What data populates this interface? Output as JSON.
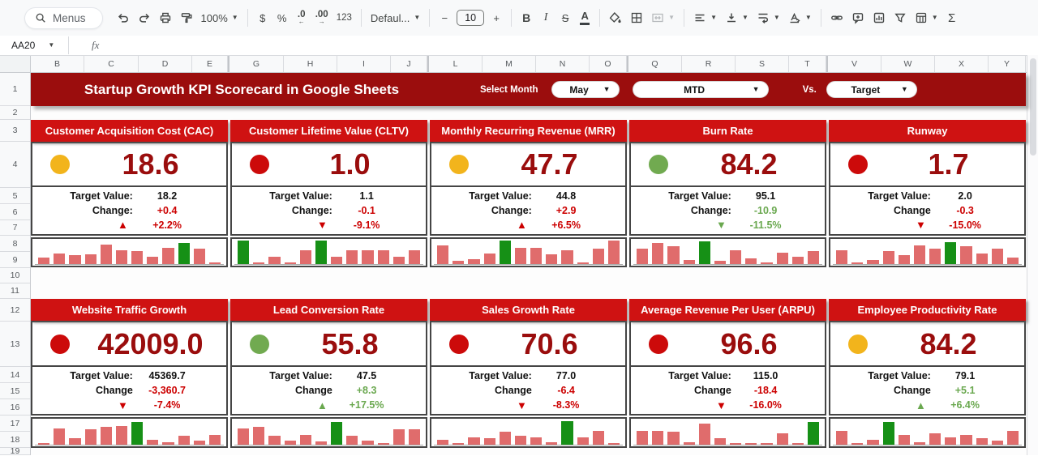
{
  "toolbar": {
    "menus": "Menus",
    "zoom": "100%",
    "currency": "$",
    "percent": "%",
    "decrease_decimals": ".0",
    "increase_decimals": ".00",
    "more_formats": "123",
    "font": "Defaul...",
    "minus": "−",
    "font_size": "10",
    "plus": "+",
    "bold": "B",
    "italic": "I",
    "strikethrough": "S",
    "text_color": "A",
    "functions": "Σ"
  },
  "formula_bar": {
    "name_box": "AA20",
    "fx": "fx"
  },
  "grid": {
    "columns": [
      "B",
      "C",
      "D",
      "E",
      "G",
      "H",
      "I",
      "J",
      "L",
      "M",
      "N",
      "O",
      "Q",
      "R",
      "S",
      "T",
      "V",
      "W",
      "X",
      "Y"
    ],
    "rows": [
      "1",
      "2",
      "3",
      "4",
      "5",
      "6",
      "7",
      "8",
      "9",
      "10",
      "11",
      "12",
      "13",
      "14",
      "15",
      "16",
      "17",
      "18",
      "19"
    ]
  },
  "header": {
    "title": "Startup Growth KPI Scorecard in Google Sheets",
    "select_month": "Select Month",
    "month": "May",
    "period": "MTD",
    "vs": "Vs.",
    "compare": "Target"
  },
  "colors": {
    "band_red": "#9b0d0d",
    "title_red": "#cf1212",
    "value_red": "#9a0d0d",
    "status_yellow": "#f2b41c",
    "status_red": "#cc0a0a",
    "status_green": "#71aa50",
    "good_green": "#6aa84f",
    "bad_red": "#cc0000",
    "spark_pink": "#e06c6c",
    "spark_green": "#169016"
  },
  "cards": [
    {
      "title": "Customer Acquisition Cost (CAC)",
      "status": "yellow",
      "value": "18.6",
      "target_label": "Target Value:",
      "target": "18.2",
      "change_label": "Change:",
      "change": "+0.4",
      "change_tone": "bad",
      "arrow": "up",
      "pct": "+2.2%",
      "spark": {
        "values": [
          0.25,
          0.42,
          0.36,
          0.4,
          0.78,
          0.56,
          0.5,
          0.3,
          0.66,
          0.85,
          0.6,
          0.06
        ],
        "green_indices": [
          9
        ]
      }
    },
    {
      "title": "Customer Lifetime Value (CLTV)",
      "status": "red",
      "value": "1.0",
      "target_label": "Target Value:",
      "target": "1.1",
      "change_label": "Change:",
      "change": "-0.1",
      "change_tone": "bad",
      "arrow": "down",
      "pct": "-9.1%",
      "spark": {
        "values": [
          0.95,
          0.05,
          0.3,
          0.08,
          0.55,
          0.95,
          0.3,
          0.55,
          0.55,
          0.55,
          0.3,
          0.55
        ],
        "green_indices": [
          0,
          5
        ]
      }
    },
    {
      "title": "Monthly Recurring Revenue (MRR)",
      "status": "yellow",
      "value": "47.7",
      "target_label": "Target Value:",
      "target": "44.8",
      "change_label": "Change:",
      "change": "+2.9",
      "change_tone": "bad",
      "arrow": "up",
      "pct": "+6.5%",
      "spark": {
        "values": [
          0.75,
          0.12,
          0.2,
          0.42,
          0.95,
          0.65,
          0.65,
          0.38,
          0.55,
          0.06,
          0.6,
          0.92
        ],
        "green_indices": [
          4
        ]
      }
    },
    {
      "title": "Burn Rate",
      "status": "green",
      "value": "84.2",
      "target_label": "Target Value:",
      "target": "95.1",
      "change_label": "Change:",
      "change": "-10.9",
      "change_tone": "good",
      "arrow": "down",
      "pct": "-11.5%",
      "spark": {
        "values": [
          0.6,
          0.85,
          0.7,
          0.15,
          0.9,
          0.12,
          0.55,
          0.22,
          0.06,
          0.45,
          0.3,
          0.5
        ],
        "green_indices": [
          4
        ]
      }
    },
    {
      "title": "Runway",
      "status": "red",
      "value": "1.7",
      "target_label": "Target Value:",
      "target": "2.0",
      "change_label": "Change",
      "change": "-0.3",
      "change_tone": "bad",
      "arrow": "down",
      "pct": "-15.0%",
      "spark": {
        "values": [
          0.55,
          0.04,
          0.16,
          0.5,
          0.35,
          0.75,
          0.62,
          0.88,
          0.72,
          0.42,
          0.62,
          0.26
        ],
        "green_indices": [
          7
        ]
      }
    },
    {
      "title": "Website Traffic Growth",
      "status": "red",
      "value": "42009.0",
      "target_label": "Target Value:",
      "target": "45369.7",
      "change_label": "Change",
      "change": "-3,360.7",
      "change_tone": "bad",
      "arrow": "down",
      "pct": "-7.4%",
      "spark": {
        "values": [
          0.06,
          0.65,
          0.25,
          0.6,
          0.7,
          0.75,
          0.9,
          0.2,
          0.1,
          0.35,
          0.15,
          0.4
        ],
        "green_indices": [
          6
        ]
      }
    },
    {
      "title": "Lead Conversion Rate",
      "status": "green",
      "value": "55.8",
      "target_label": "Target Value:",
      "target": "47.5",
      "change_label": "Change",
      "change": "+8.3",
      "change_tone": "good",
      "arrow": "up",
      "pct": "+17.5%",
      "spark": {
        "values": [
          0.65,
          0.7,
          0.35,
          0.15,
          0.4,
          0.12,
          0.9,
          0.35,
          0.15,
          0.04,
          0.6,
          0.6
        ],
        "green_indices": [
          6
        ]
      }
    },
    {
      "title": "Sales Growth Rate",
      "status": "red",
      "value": "70.6",
      "target_label": "Target Value:",
      "target": "77.0",
      "change_label": "Change",
      "change": "-6.4",
      "change_tone": "bad",
      "arrow": "down",
      "pct": "-8.3%",
      "spark": {
        "values": [
          0.2,
          0.05,
          0.3,
          0.25,
          0.5,
          0.35,
          0.3,
          0.1,
          0.95,
          0.3,
          0.55,
          0.08
        ],
        "green_indices": [
          8
        ]
      }
    },
    {
      "title": "Average Revenue Per User (ARPU)",
      "status": "red",
      "value": "96.6",
      "target_label": "Target Value:",
      "target": "115.0",
      "change_label": "Change",
      "change": "-18.4",
      "change_tone": "bad",
      "arrow": "down",
      "pct": "-16.0%",
      "spark": {
        "values": [
          0.55,
          0.55,
          0.5,
          0.1,
          0.85,
          0.25,
          0.05,
          0.08,
          0.08,
          0.45,
          0.06,
          0.9
        ],
        "green_indices": [
          11
        ]
      }
    },
    {
      "title": "Employee Productivity Rate",
      "status": "yellow",
      "value": "84.2",
      "target_label": "Target Value:",
      "target": "79.1",
      "change_label": "Change",
      "change": "+5.1",
      "change_tone": "good",
      "arrow": "up",
      "pct": "+6.4%",
      "spark": {
        "values": [
          0.55,
          0.06,
          0.2,
          0.9,
          0.4,
          0.1,
          0.45,
          0.3,
          0.4,
          0.25,
          0.15,
          0.55
        ],
        "green_indices": [
          3
        ]
      }
    }
  ]
}
